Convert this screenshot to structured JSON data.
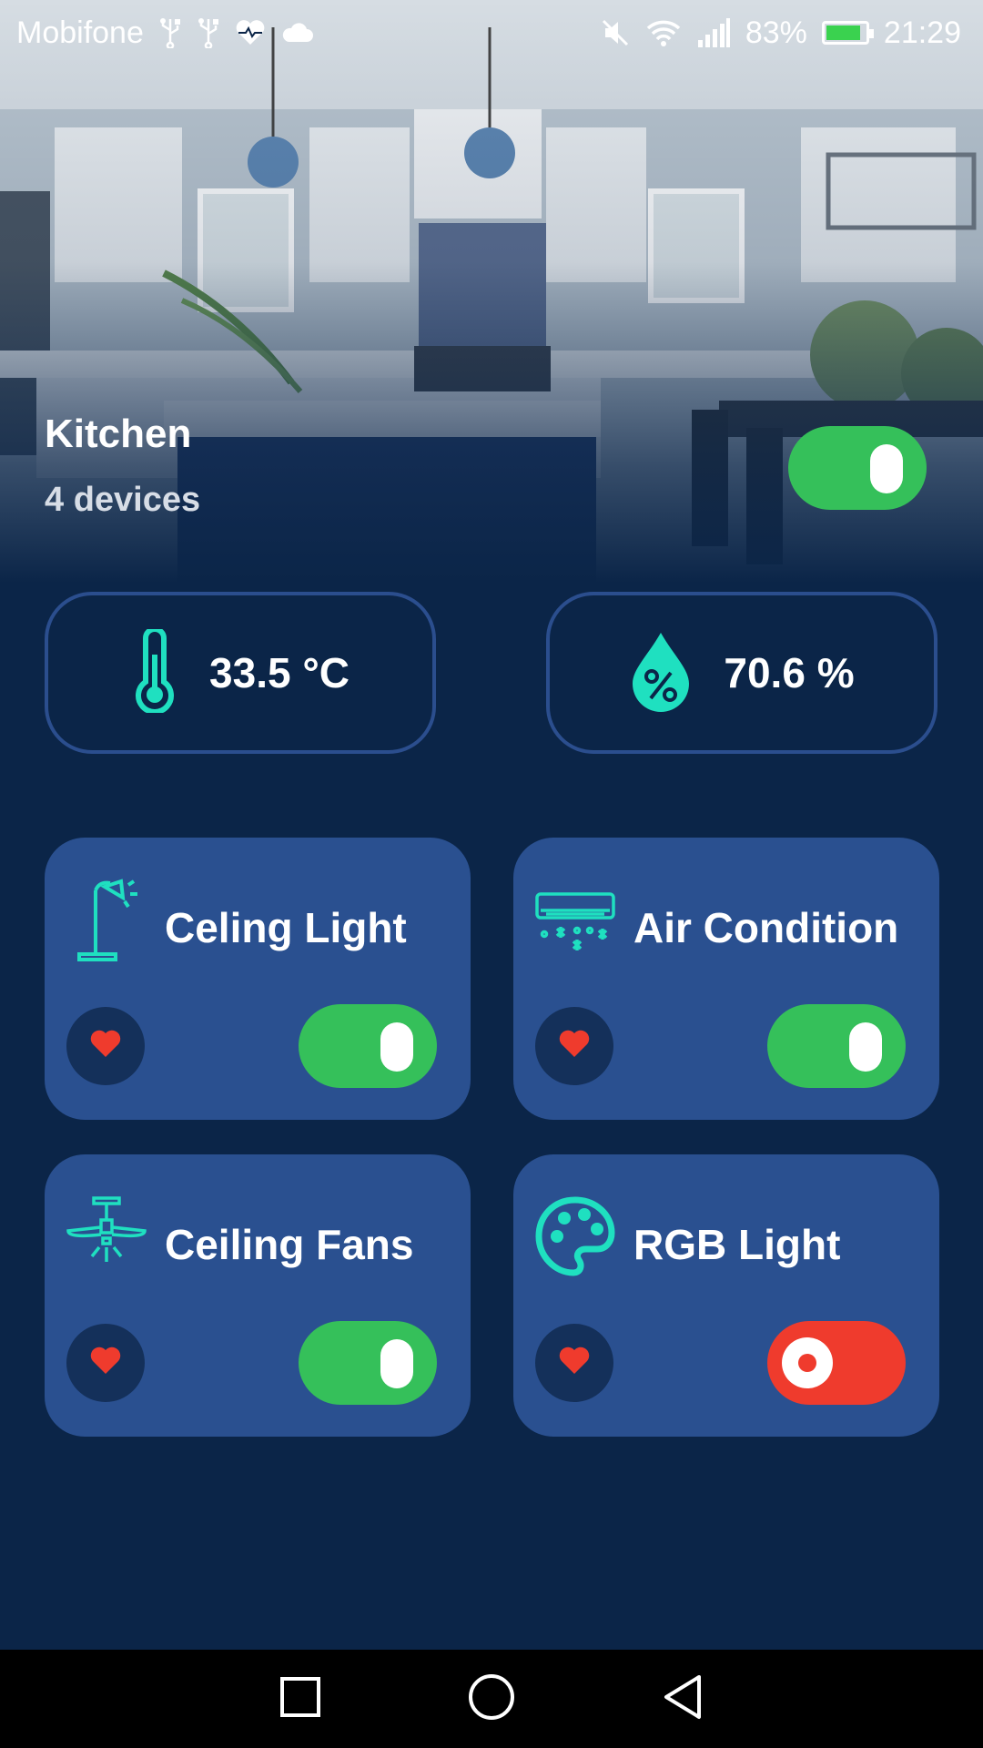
{
  "status_bar": {
    "carrier": "Mobifone",
    "battery_percent": "83%",
    "battery_level": 0.83,
    "time": "21:29",
    "icons": [
      "usb-icon",
      "usb-icon",
      "heart-health-icon",
      "cloud-icon",
      "mute-icon",
      "wifi-icon",
      "signal-icon",
      "battery-charging-icon"
    ]
  },
  "room": {
    "name": "Kitchen",
    "device_count": "4 devices",
    "master_toggle_on": true
  },
  "sensors": {
    "temperature": {
      "icon": "thermometer-icon",
      "value": "33.5 °C"
    },
    "humidity": {
      "icon": "humidity-drop-icon",
      "value": "70.6 %"
    }
  },
  "devices": [
    {
      "name": "Celing Light",
      "icon": "desk-lamp-icon",
      "on": true
    },
    {
      "name": "Air Condition",
      "icon": "air-conditioner-icon",
      "on": true
    },
    {
      "name": "Ceiling Fans",
      "icon": "ceiling-fan-icon",
      "on": true
    },
    {
      "name": "RGB Light",
      "icon": "palette-icon",
      "on": false
    }
  ],
  "colors": {
    "background": "#0b2548",
    "card": "#2a5090",
    "accent_teal": "#1fe0c0",
    "toggle_on": "#35c05a",
    "toggle_off": "#ef3b2d",
    "heart": "#ef3b2d"
  },
  "nav": [
    "recent-apps-icon",
    "home-icon",
    "back-icon"
  ]
}
